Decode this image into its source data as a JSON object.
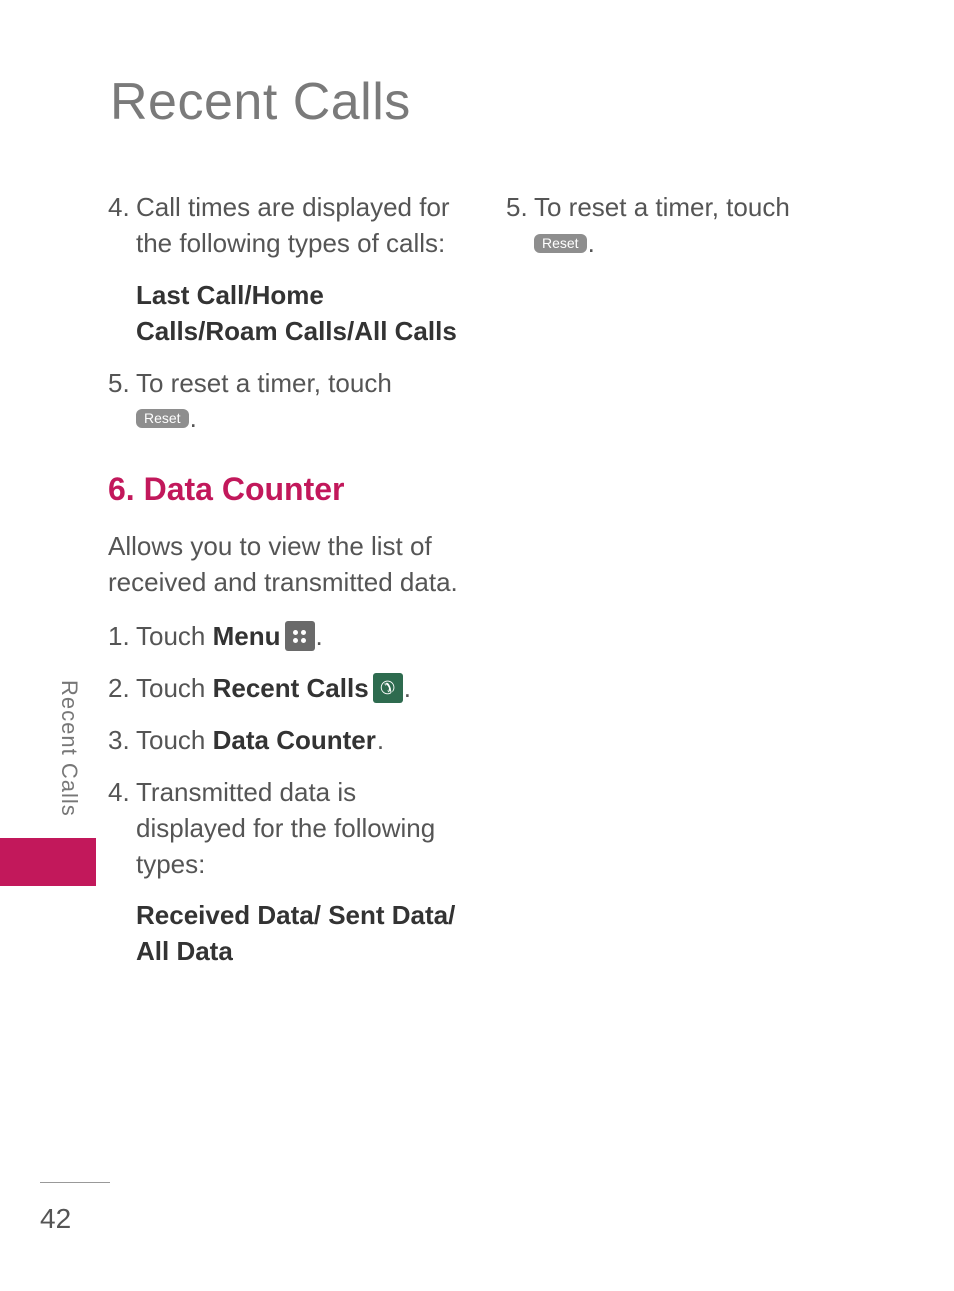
{
  "page_title": "Recent Calls",
  "side_tab_label": "Recent Calls",
  "page_number": "42",
  "left_column": {
    "step4_num": "4.",
    "step4_text": "Call times are displayed for the following types of calls:",
    "step4_sub": "Last Call/Home Calls/Roam Calls/All Calls",
    "step5_num": "5.",
    "step5_text": "To reset a timer, touch",
    "step5_btn": "Reset",
    "section6_heading": "6. Data Counter",
    "section6_intro": "Allows you to view the list of received and transmitted data.",
    "dc1_num": "1.",
    "dc1_text_a": "Touch ",
    "dc1_bold": "Menu",
    "dc2_num": "2.",
    "dc2_text_a": "Touch ",
    "dc2_bold": "Recent Calls",
    "dc3_num": "3.",
    "dc3_text_a": "Touch ",
    "dc3_bold": "Data Counter",
    "dc4_num": "4.",
    "dc4_text": "Transmitted data is displayed for the following types:",
    "dc4_sub": "Received Data/ Sent Data/ All Data"
  },
  "right_column": {
    "step5_num": "5.",
    "step5_text": "To reset a timer, touch",
    "step5_btn": "Reset"
  },
  "icons": {
    "menu": "menu-icon",
    "recent_calls": "recent-calls-icon"
  }
}
